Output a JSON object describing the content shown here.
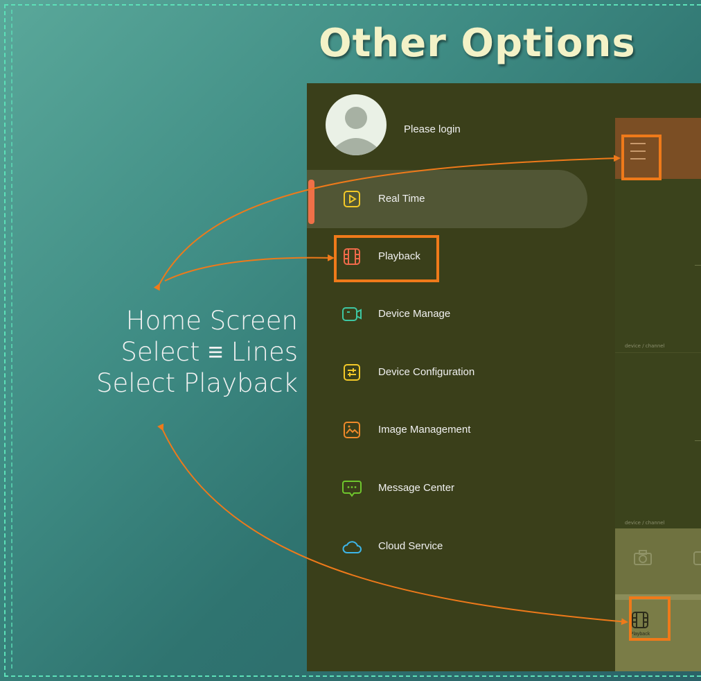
{
  "slide": {
    "title": "Other Options",
    "caption_lines": [
      "Home Screen",
      "Select ≡ Lines",
      "Select Playback"
    ]
  },
  "app": {
    "login_text": "Please login",
    "menu_items": [
      {
        "label": "Real Time",
        "icon": "play-icon",
        "color": "#f3c928",
        "active": true
      },
      {
        "label": "Playback",
        "icon": "film-icon",
        "color": "#ef6a4a",
        "active": false
      },
      {
        "label": "Device Manage",
        "icon": "video-camera-icon",
        "color": "#3ec7a3",
        "active": false
      },
      {
        "label": "Device Configuration",
        "icon": "sliders-icon",
        "color": "#f3c928",
        "active": false
      },
      {
        "label": "Image Management",
        "icon": "image-icon",
        "color": "#f08a2a",
        "active": false
      },
      {
        "label": "Message Center",
        "icon": "chat-icon",
        "color": "#6fc62d",
        "active": false
      },
      {
        "label": "Cloud Service",
        "icon": "cloud-icon",
        "color": "#3db5e8",
        "active": false
      }
    ],
    "channel_labels": [
      "device / channel",
      "device / channel"
    ],
    "bottom_playback_label": "Playback"
  },
  "colors": {
    "highlight": "#ef7a1a",
    "title": "#f3f2c7",
    "drawer_bg": "#3a3f1a"
  }
}
